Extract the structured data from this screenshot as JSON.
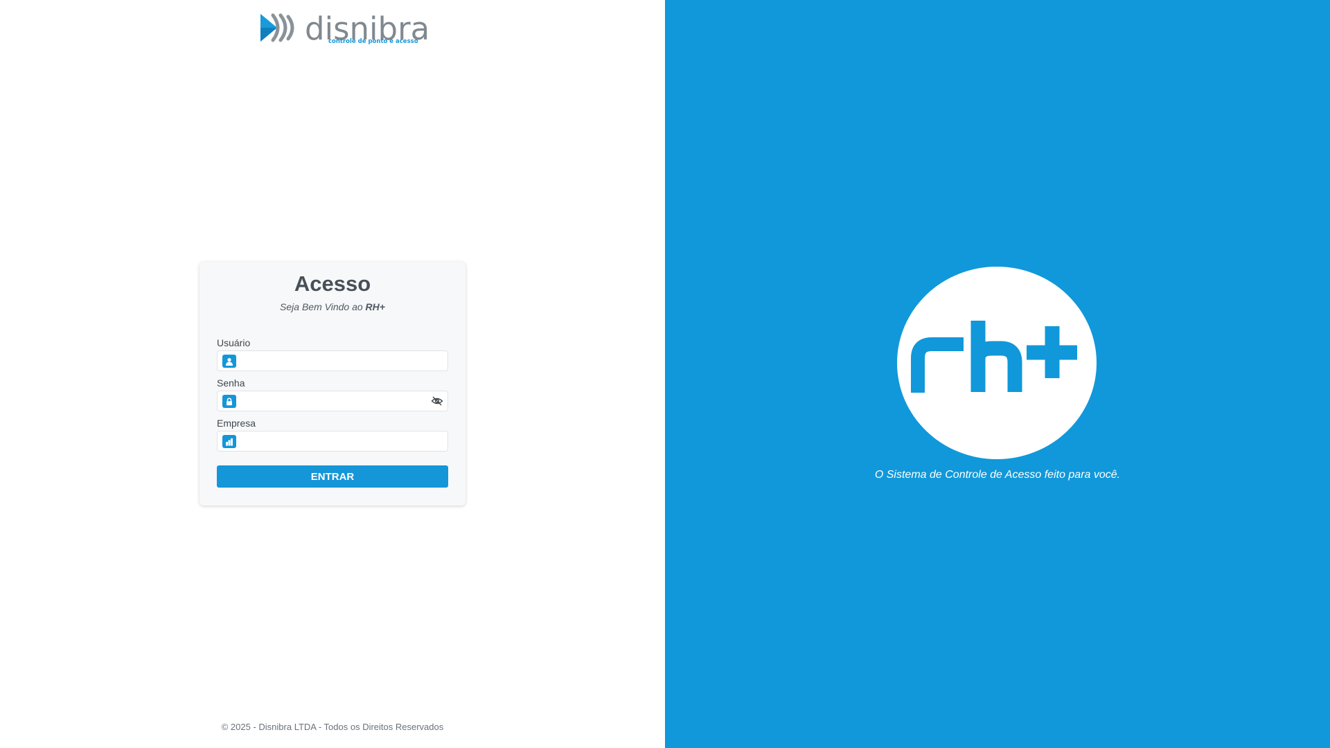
{
  "brand": {
    "name": "disnibra",
    "tagline": "controle de ponto e acesso"
  },
  "login": {
    "title": "Acesso",
    "subtitle_prefix": "Seja Bem Vindo ao ",
    "subtitle_product": "RH+",
    "fields": {
      "user": {
        "label": "Usuário",
        "value": "",
        "icon": "user-icon"
      },
      "password": {
        "label": "Senha",
        "value": "",
        "icon": "lock-icon",
        "toggle_icon": "eye-slash-icon"
      },
      "company": {
        "label": "Empresa",
        "value": "",
        "icon": "building-icon"
      }
    },
    "submit_label": "ENTRAR"
  },
  "footer": {
    "text": "© 2025 - Disnibra LTDA - Todos os Direitos Reservados"
  },
  "promo": {
    "logo_text": "rh+",
    "slogan": "O Sistema de Controle de Acesso feito para você."
  },
  "colors": {
    "accent": "#1496d8",
    "right_panel": "#1098da",
    "card_background": "#f7f8f9"
  }
}
